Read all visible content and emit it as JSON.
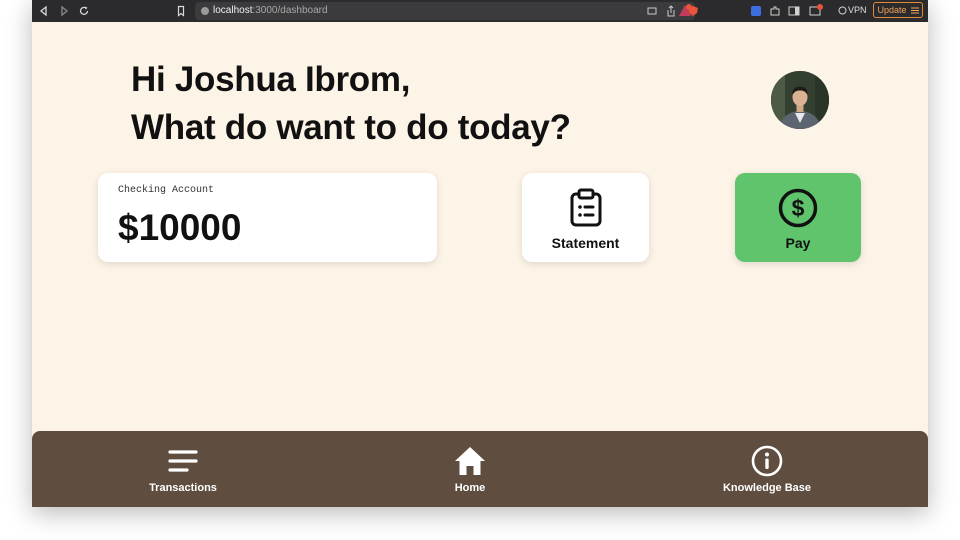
{
  "browser": {
    "url_host": "localhost",
    "url_path": ":3000/dashboard",
    "vpn_label": "VPN",
    "update_label": "Update",
    "shield_badge_count": "1"
  },
  "greeting": {
    "line1": "Hi Joshua Ibrom,",
    "line2": "What do want to do today?"
  },
  "account": {
    "label": "Checking Account",
    "balance": "$10000"
  },
  "actions": {
    "statement_label": "Statement",
    "pay_label": "Pay"
  },
  "nav": {
    "transactions_label": "Transactions",
    "home_label": "Home",
    "knowledge_label": "Knowledge Base"
  },
  "colors": {
    "page_background": "#fdf4e8",
    "pay_accent": "#5fc46b",
    "nav_background": "#5f4e3f",
    "update_accent": "#e08a3c"
  },
  "icons": {
    "statement": "clipboard-icon",
    "pay": "dollar-circle-icon",
    "transactions": "menu-lines-icon",
    "home": "house-icon",
    "knowledge": "info-circle-icon"
  }
}
